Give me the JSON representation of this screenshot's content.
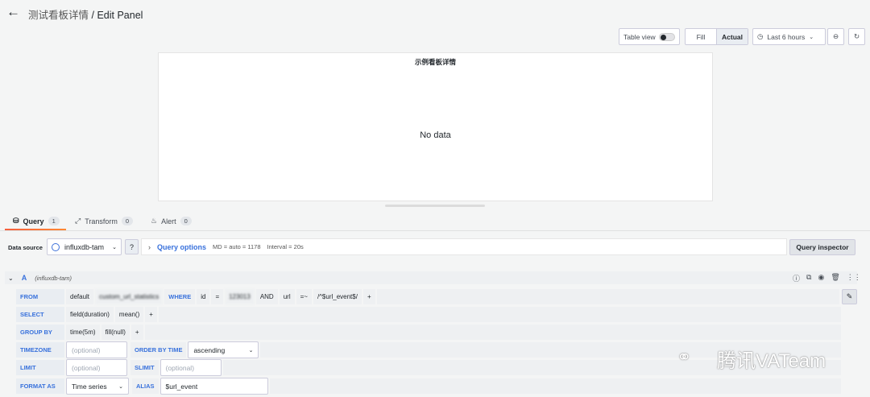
{
  "header": {
    "dashboard_title": "测试看板详情",
    "separator": " / ",
    "page_title": "Edit Panel"
  },
  "toolbar": {
    "table_view_label": "Table view",
    "fill_label": "Fill",
    "actual_label": "Actual",
    "time_range": "Last 6 hours"
  },
  "panel": {
    "title": "示例看板详情",
    "empty_text": "No data"
  },
  "tabs": [
    {
      "label": "Query",
      "count": "1"
    },
    {
      "label": "Transform",
      "count": "0"
    },
    {
      "label": "Alert",
      "count": "0"
    }
  ],
  "datasource": {
    "label": "Data source",
    "value": "influxdb-tam",
    "query_options_label": "Query options",
    "md_info": "MD = auto = 1178",
    "interval_info": "Interval = 20s",
    "inspector_label": "Query inspector"
  },
  "query": {
    "ref_id": "A",
    "datasource_name": "(influxdb-tam)",
    "from": {
      "keyword": "FROM",
      "policy": "default",
      "measurement": "custom_url_statistics",
      "where_kw": "WHERE",
      "tag1": "id",
      "op1": "=",
      "val1": "123013",
      "and_kw": "AND",
      "tag2": "url",
      "op2": "=~",
      "val2": "/^$url_event$/",
      "plus": "+"
    },
    "select": {
      "keyword": "SELECT",
      "field": "field(duration)",
      "agg": "mean()",
      "plus": "+"
    },
    "group_by": {
      "keyword": "GROUP BY",
      "time": "time(5m)",
      "fill": "fill(null)",
      "plus": "+"
    },
    "timezone": {
      "keyword": "TIMEZONE",
      "placeholder": "(optional)",
      "order_kw": "ORDER BY TIME",
      "order_value": "ascending"
    },
    "limit": {
      "keyword": "LIMIT",
      "placeholder": "(optional)",
      "slimit_kw": "SLIMIT",
      "slimit_placeholder": "(optional)"
    },
    "format": {
      "keyword": "FORMAT AS",
      "value": "Time series",
      "alias_kw": "ALIAS",
      "alias_value": "$url_event"
    }
  },
  "watermark": {
    "text": "腾讯VATeam"
  },
  "icons": [
    "arrow-left-icon",
    "clock-icon",
    "chevron-down-icon",
    "zoom-out-icon",
    "refresh-icon",
    "database-icon",
    "transform-icon",
    "bell-icon",
    "question-icon",
    "copy-icon",
    "eye-icon",
    "trash-icon",
    "drag-icon",
    "pencil-icon"
  ]
}
